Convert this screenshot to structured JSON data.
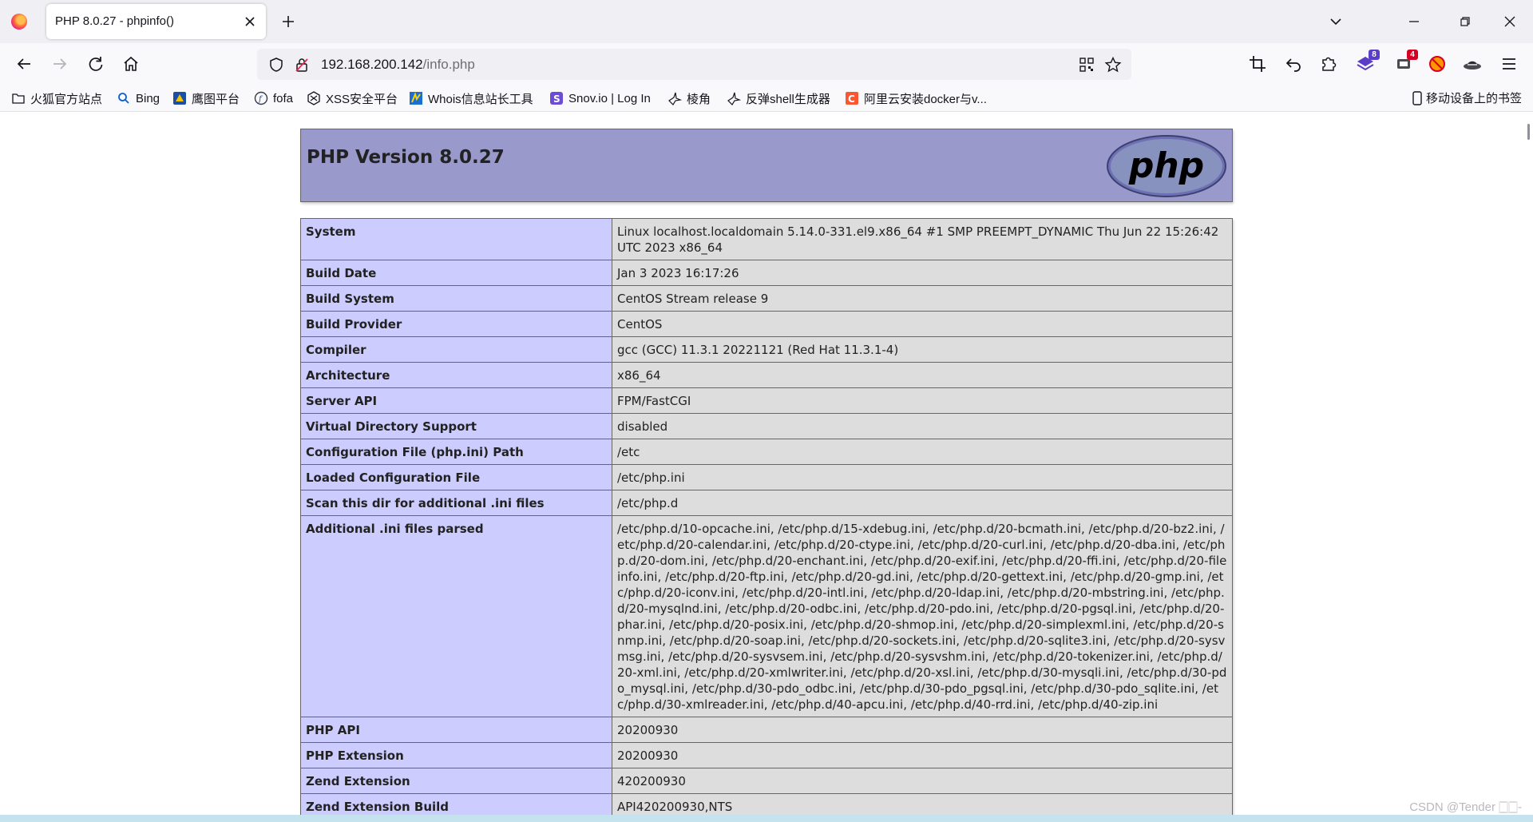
{
  "browser": {
    "tab": {
      "title": "PHP 8.0.27 - phpinfo()"
    },
    "url": {
      "host": "192.168.200.142",
      "path": "/info.php"
    },
    "toolbar_badges": {
      "extension_a": "8",
      "extension_b": "4"
    },
    "bookmarks": [
      {
        "label": "火狐官方站点",
        "icon": "folder-icon"
      },
      {
        "label": "Bing",
        "icon": "search-icon"
      },
      {
        "label": "鹰图平台",
        "icon": "hunter-icon"
      },
      {
        "label": "fofa",
        "icon": "fofa-icon"
      },
      {
        "label": "XSS安全平台",
        "icon": "xss-icon"
      },
      {
        "label": "Whois信息站长工具",
        "icon": "whois-icon"
      },
      {
        "label": "Snov.io | Log In",
        "icon": "snov-icon"
      },
      {
        "label": "棱角",
        "icon": "bird-icon"
      },
      {
        "label": "反弹shell生成器",
        "icon": "bird-icon"
      },
      {
        "label": "阿里云安装docker与v...",
        "icon": "csdn-icon"
      }
    ],
    "mobile_bookmarks": "移动设备上的书签"
  },
  "colors": {
    "php_header": "#9999cc",
    "key_cell": "#ccccff",
    "value_cell": "#dddddd"
  },
  "php": {
    "version_heading": "PHP Version 8.0.27",
    "logo_text": "php",
    "rows": [
      {
        "key": "System",
        "value": "Linux localhost.localdomain 5.14.0-331.el9.x86_64 #1 SMP PREEMPT_DYNAMIC Thu Jun 22 15:26:42 UTC 2023 x86_64"
      },
      {
        "key": "Build Date",
        "value": "Jan 3 2023 16:17:26"
      },
      {
        "key": "Build System",
        "value": "CentOS Stream release 9"
      },
      {
        "key": "Build Provider",
        "value": "CentOS"
      },
      {
        "key": "Compiler",
        "value": "gcc (GCC) 11.3.1 20221121 (Red Hat 11.3.1-4)"
      },
      {
        "key": "Architecture",
        "value": "x86_64"
      },
      {
        "key": "Server API",
        "value": "FPM/FastCGI"
      },
      {
        "key": "Virtual Directory Support",
        "value": "disabled"
      },
      {
        "key": "Configuration File (php.ini) Path",
        "value": "/etc"
      },
      {
        "key": "Loaded Configuration File",
        "value": "/etc/php.ini"
      },
      {
        "key": "Scan this dir for additional .ini files",
        "value": "/etc/php.d"
      },
      {
        "key": "Additional .ini files parsed",
        "value": "/etc/php.d/10-opcache.ini, /etc/php.d/15-xdebug.ini, /etc/php.d/20-bcmath.ini, /etc/php.d/20-bz2.ini, /etc/php.d/20-calendar.ini, /etc/php.d/20-ctype.ini, /etc/php.d/20-curl.ini, /etc/php.d/20-dba.ini, /etc/php.d/20-dom.ini, /etc/php.d/20-enchant.ini, /etc/php.d/20-exif.ini, /etc/php.d/20-ffi.ini, /etc/php.d/20-fileinfo.ini, /etc/php.d/20-ftp.ini, /etc/php.d/20-gd.ini, /etc/php.d/20-gettext.ini, /etc/php.d/20-gmp.ini, /etc/php.d/20-iconv.ini, /etc/php.d/20-intl.ini, /etc/php.d/20-ldap.ini, /etc/php.d/20-mbstring.ini, /etc/php.d/20-mysqlnd.ini, /etc/php.d/20-odbc.ini, /etc/php.d/20-pdo.ini, /etc/php.d/20-pgsql.ini, /etc/php.d/20-phar.ini, /etc/php.d/20-posix.ini, /etc/php.d/20-shmop.ini, /etc/php.d/20-simplexml.ini, /etc/php.d/20-snmp.ini, /etc/php.d/20-soap.ini, /etc/php.d/20-sockets.ini, /etc/php.d/20-sqlite3.ini, /etc/php.d/20-sysvmsg.ini, /etc/php.d/20-sysvsem.ini, /etc/php.d/20-sysvshm.ini, /etc/php.d/20-tokenizer.ini, /etc/php.d/20-xml.ini, /etc/php.d/20-xmlwriter.ini, /etc/php.d/20-xsl.ini, /etc/php.d/30-mysqli.ini, /etc/php.d/30-pdo_mysql.ini, /etc/php.d/30-pdo_odbc.ini, /etc/php.d/30-pdo_pgsql.ini, /etc/php.d/30-pdo_sqlite.ini, /etc/php.d/30-xmlreader.ini, /etc/php.d/40-apcu.ini, /etc/php.d/40-rrd.ini, /etc/php.d/40-zip.ini"
      },
      {
        "key": "PHP API",
        "value": "20200930"
      },
      {
        "key": "PHP Extension",
        "value": "20200930"
      },
      {
        "key": "Zend Extension",
        "value": "420200930"
      },
      {
        "key": "Zend Extension Build",
        "value": "API420200930,NTS"
      }
    ]
  },
  "watermark": "CSDN @Tender 🀆🀆-"
}
